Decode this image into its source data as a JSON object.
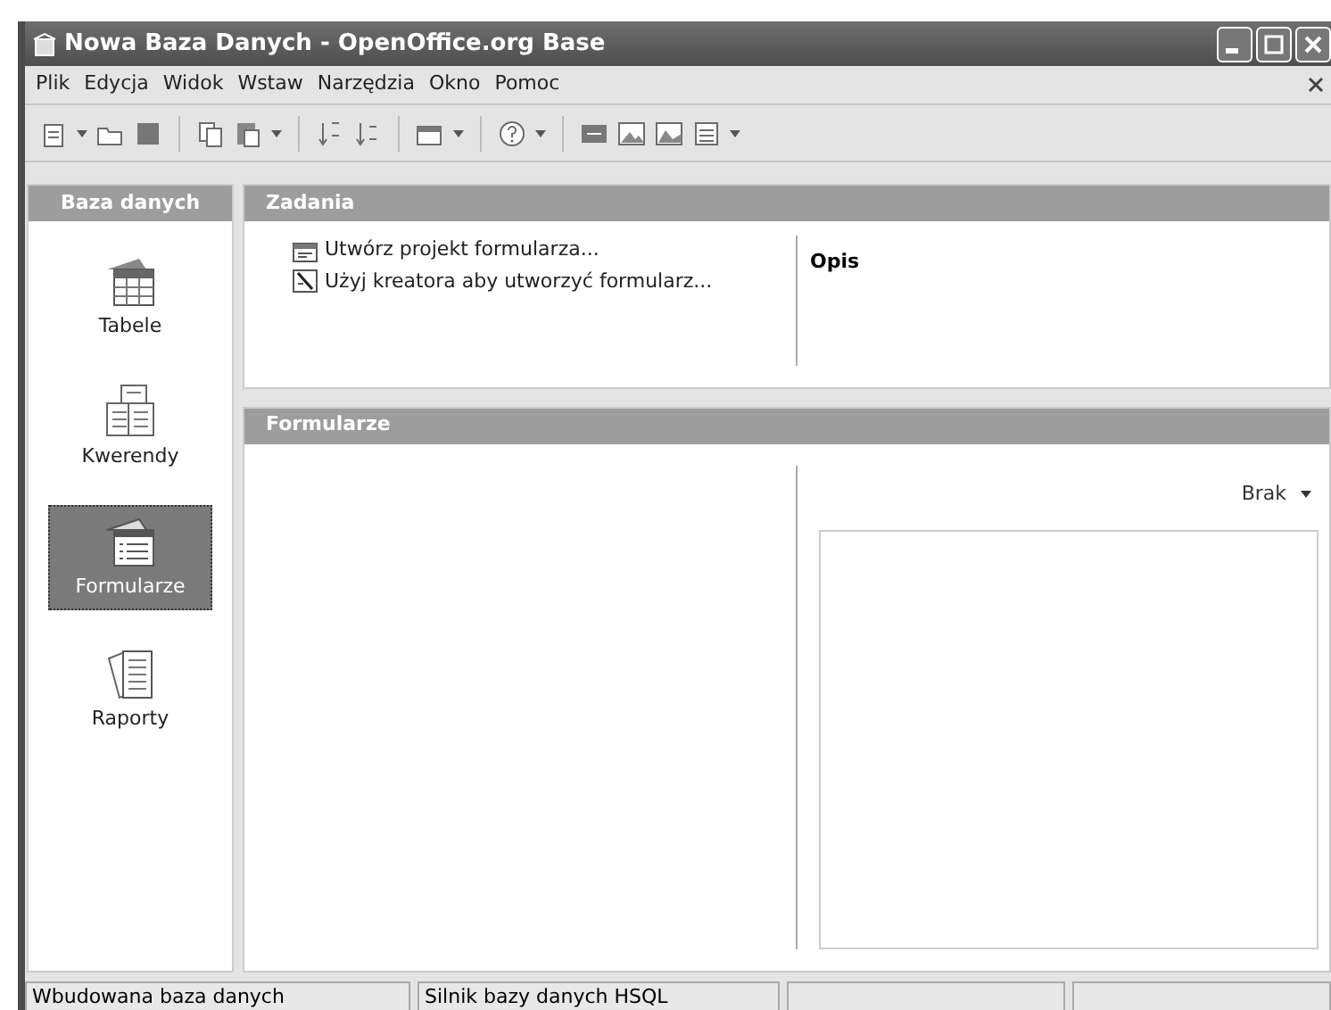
{
  "window": {
    "title": "Nowa Baza Danych - OpenOffice.org Base"
  },
  "menu": [
    "Plik",
    "Edycja",
    "Widok",
    "Wstaw",
    "Narzędzia",
    "Okno",
    "Pomoc"
  ],
  "sidebar": {
    "title": "Baza danych",
    "items": [
      {
        "label": "Tabele",
        "kind": "table",
        "selected": false
      },
      {
        "label": "Kwerendy",
        "kind": "query",
        "selected": false
      },
      {
        "label": "Formularze",
        "kind": "form",
        "selected": true
      },
      {
        "label": "Raporty",
        "kind": "report",
        "selected": false
      }
    ]
  },
  "tasks": {
    "title": "Zadania",
    "items": [
      {
        "label": "Utwórz projekt formularza...",
        "kind": "design"
      },
      {
        "label": "Użyj kreatora aby utworzyć formularz...",
        "kind": "wizard"
      }
    ],
    "description_title": "Opis"
  },
  "forms": {
    "title": "Formularze",
    "preview": "Brak"
  },
  "status_bar": [
    "Wbudowana baza danych",
    "Silnik bazy danych HSQL"
  ]
}
